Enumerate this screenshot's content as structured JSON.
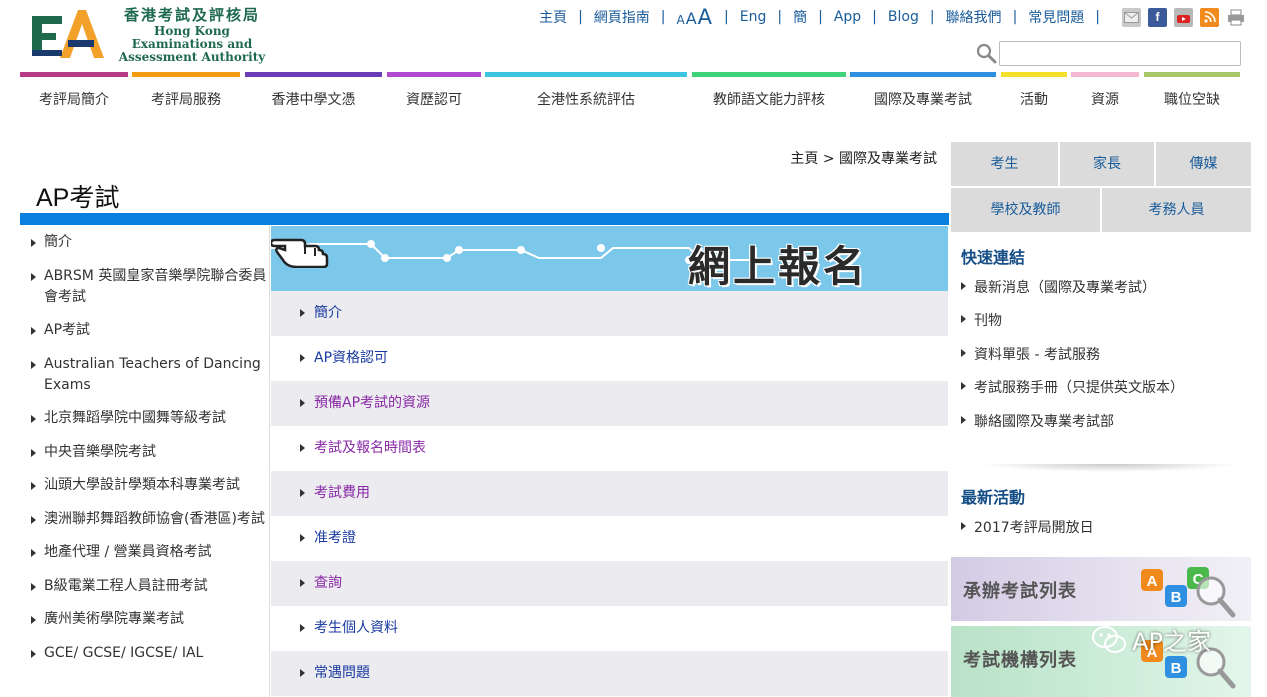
{
  "logo": {
    "cn": "香港考試及評核局",
    "en1": "Hong Kong",
    "en2": "Examinations and",
    "en3": "Assessment Authority"
  },
  "toplinks": {
    "home": "主頁",
    "guide": "網頁指南",
    "fs_small": "A",
    "fs_mid": "A",
    "fs_large": "A",
    "eng": "Eng",
    "simp": "簡",
    "app": "App",
    "blog": "Blog",
    "contact": "聯絡我們",
    "faq": "常見問題"
  },
  "search": {
    "placeholder": ""
  },
  "nav": [
    "考評局簡介",
    "考評局服務",
    "香港中學文憑",
    "資歷認可",
    "全港性系統評估",
    "教師語文能力評核",
    "國際及專業考試",
    "活動",
    "資源",
    "職位空缺"
  ],
  "nav_colors": [
    "#b63c88",
    "#f39c12",
    "#6a3cb5",
    "#b04ad0",
    "#3cc5e0",
    "#3fd47a",
    "#2f8fe0",
    "#f2e02a",
    "#f5b6d2",
    "#a9c56a"
  ],
  "breadcrumb": {
    "home": "主頁",
    "sep": ">",
    "current": "國際及專業考試"
  },
  "page_title": "AP考試",
  "left_menu": [
    "簡介",
    "ABRSM 英國皇家音樂學院聯合委員會考試",
    "AP考試",
    "Australian Teachers of Dancing Exams",
    "北京舞蹈學院中國舞等級考試",
    "中央音樂學院考試",
    "汕頭大學設計學類本科專業考試",
    "澳洲聯邦舞蹈教師協會(香港區)考試",
    "地產代理 / 營業員資格考試",
    "B級電業工程人員註冊考試",
    "廣州美術學院專業考試",
    "GCE/ GCSE/ IGCSE/ IAL"
  ],
  "banner": {
    "text": "網上報名"
  },
  "center_menu": [
    {
      "label": "簡介",
      "color": "#1a3aa0"
    },
    {
      "label": "AP資格認可",
      "color": "#1a3aa0"
    },
    {
      "label": "預備AP考試的資源",
      "color": "#8a2aa6"
    },
    {
      "label": "考試及報名時間表",
      "color": "#8a2aa6"
    },
    {
      "label": "考試費用",
      "color": "#8a2aa6"
    },
    {
      "label": "准考證",
      "color": "#1a3aa0"
    },
    {
      "label": "查詢",
      "color": "#8a2aa6"
    },
    {
      "label": "考生個人資料",
      "color": "#1a3aa0"
    },
    {
      "label": "常遇問題",
      "color": "#1a3aa0"
    }
  ],
  "right_tabs": [
    "考生",
    "家長",
    "傳媒",
    "學校及教師",
    "考務人員"
  ],
  "quick_links": {
    "title": "快速連結",
    "items": [
      "最新消息（國際及專業考試）",
      "刊物",
      "資料單張 - 考試服務",
      "考試服務手冊（只提供英文版本）",
      "聯絡國際及專業考試部"
    ]
  },
  "latest": {
    "title": "最新活動",
    "items": [
      "2017考評局開放日"
    ]
  },
  "cards": [
    "承辦考試列表",
    "考試機構列表"
  ],
  "watermark": "AP之家"
}
